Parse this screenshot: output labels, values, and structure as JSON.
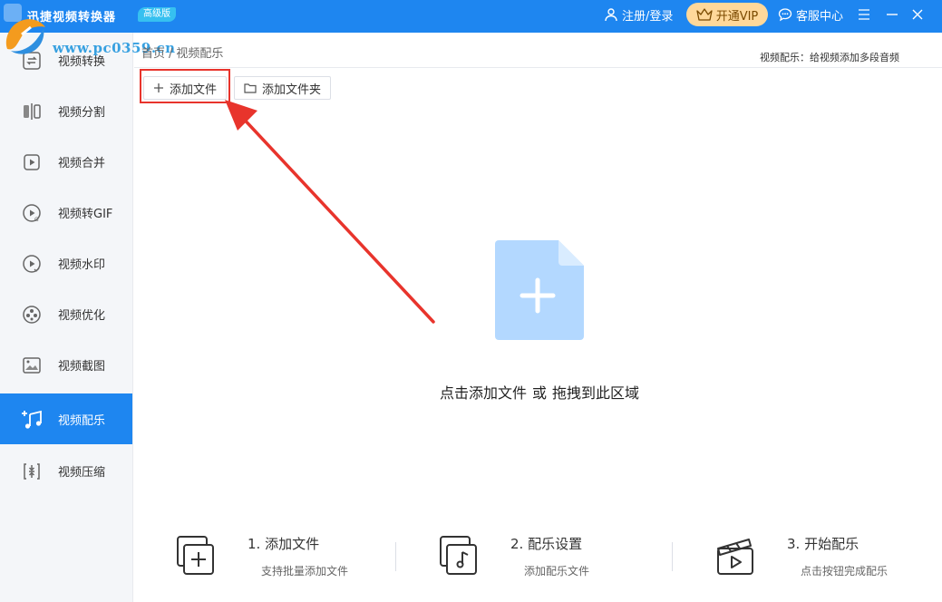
{
  "titlebar": {
    "app_title": "迅捷视频转换器",
    "version_badge": "高级版",
    "register_login": "注册/登录",
    "vip_label": "开通VIP",
    "service_label": "客服中心",
    "icons": [
      "user-icon",
      "crown-icon",
      "chat-icon",
      "menu-icon",
      "minimize-icon",
      "close-icon"
    ]
  },
  "watermark": {
    "text": "www.pc0359.cn"
  },
  "sidebar": {
    "items": [
      {
        "label": "视频转换",
        "icon": "convert-icon"
      },
      {
        "label": "视频分割",
        "icon": "split-icon"
      },
      {
        "label": "视频合并",
        "icon": "merge-icon"
      },
      {
        "label": "视频转GIF",
        "icon": "gif-icon"
      },
      {
        "label": "视频水印",
        "icon": "watermark-icon"
      },
      {
        "label": "视频优化",
        "icon": "optimize-icon"
      },
      {
        "label": "视频截图",
        "icon": "screenshot-icon"
      },
      {
        "label": "视频配乐",
        "icon": "music-icon",
        "active": true
      },
      {
        "label": "视频压缩",
        "icon": "compress-icon"
      }
    ]
  },
  "breadcrumb": {
    "home": "首页",
    "separator": "/",
    "current": "视频配乐"
  },
  "page_desc": "视频配乐：给视频添加多段音频",
  "toolbar": {
    "add_file": "添加文件",
    "add_folder": "添加文件夹"
  },
  "dropzone": {
    "text_click": "点击添加文件",
    "text_or": "或",
    "text_drag": "拖拽到此区域"
  },
  "steps": [
    {
      "title": "1. 添加文件",
      "desc": "支持批量添加文件"
    },
    {
      "title": "2. 配乐设置",
      "desc": "添加配乐文件"
    },
    {
      "title": "3. 开始配乐",
      "desc": "点击按钮完成配乐"
    }
  ],
  "colors": {
    "brand": "#1e86f0",
    "highlight": "#e8342c",
    "vip": "#ffd89a",
    "sidebar_bg": "#f4f6f9"
  }
}
